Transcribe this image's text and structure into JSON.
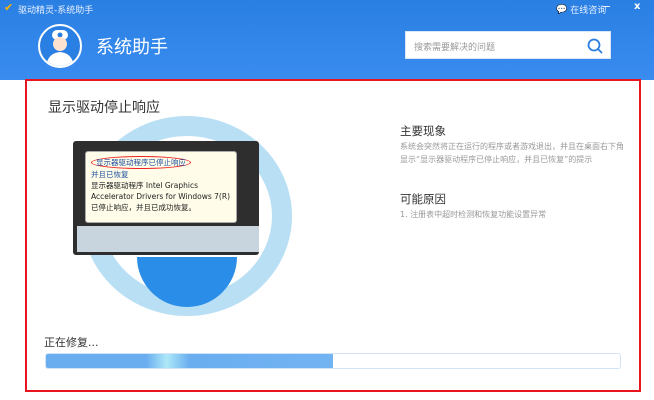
{
  "window": {
    "title": "驱动精灵-系统助手",
    "consult_label": "在线咨询",
    "minimize": "−",
    "close": "x"
  },
  "header": {
    "title": "系统助手",
    "search_placeholder": "搜索需要解决的问题"
  },
  "issue": {
    "title": "显示驱动停止响应",
    "popup_lines": [
      "显示器驱动程序已停止响应",
      "并且已恢复",
      "显示器驱动程序 Intel Graphics",
      "Accelerator Drivers for Windows 7(R)",
      "已停止响应，并且已成功恢复。"
    ],
    "symptom_heading": "主要现象",
    "symptom_text": "系统会突然将正在运行的程序或者游戏退出，并且在桌面右下角显示“显示器驱动程序已停止响应，并且已恢复”的提示",
    "cause_heading": "可能原因",
    "cause_text": "1. 注册表中超时检测和恢复功能设置异常"
  },
  "progress": {
    "label": "正在修复...",
    "percent": 50
  },
  "colors": {
    "header": "#2a7fe3",
    "frame": "#e8141e",
    "progress": "#6aaef0"
  }
}
